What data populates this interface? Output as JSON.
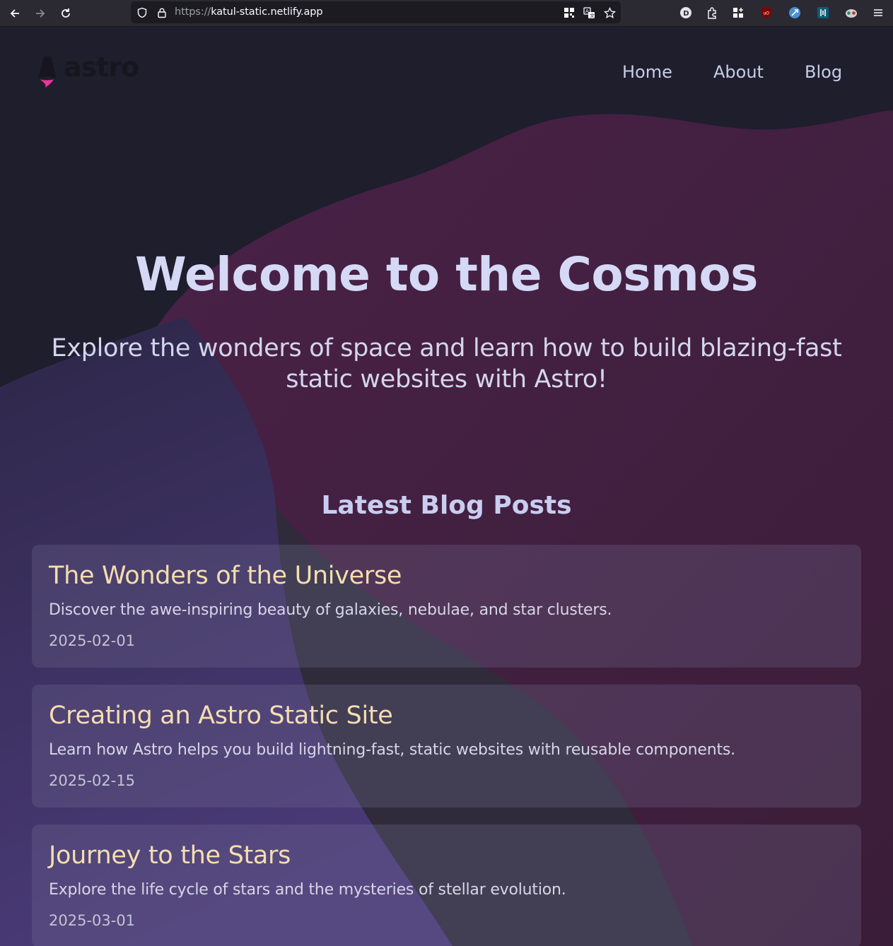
{
  "browser": {
    "url_protocol": "https://",
    "url_host": "katul-static.netlify.app",
    "icons": [
      "back-icon",
      "forward-icon",
      "reload-icon",
      "shield-icon",
      "lock-icon",
      "qr-code-icon",
      "translate-icon",
      "bookmark-star-icon",
      "duckduckgo-extension-icon",
      "extensions-icon",
      "apps-grid-icon",
      "ublock-icon",
      "bitwarden-icon",
      "extension-icon",
      "privacy-badger-icon",
      "menu-icon"
    ]
  },
  "site": {
    "logo_text": "astro",
    "nav": [
      "Home",
      "About",
      "Blog"
    ]
  },
  "hero": {
    "title": "Welcome to the Cosmos",
    "subtitle": "Explore the wonders of space and learn how to build blazing-fast static websites with Astro!"
  },
  "blog": {
    "heading": "Latest Blog Posts",
    "posts": [
      {
        "title": "The Wonders of the Universe",
        "description": "Discover the awe-inspiring beauty of galaxies, nebulae, and star clusters.",
        "date": "2025-02-01"
      },
      {
        "title": "Creating an Astro Static Site",
        "description": "Learn how Astro helps you build lightning-fast, static websites with reusable components.",
        "date": "2025-02-15"
      },
      {
        "title": "Journey to the Stars",
        "description": "Explore the life cycle of stars and the mysteries of stellar evolution.",
        "date": "2025-03-01"
      }
    ]
  },
  "colors": {
    "page_bg": "#1e1e2d",
    "blob_magenta": "#3d1f3f",
    "blob_purple": "#3a2b5c",
    "card_title": "#f5ddb0",
    "logo_accent": "#e8369a"
  }
}
